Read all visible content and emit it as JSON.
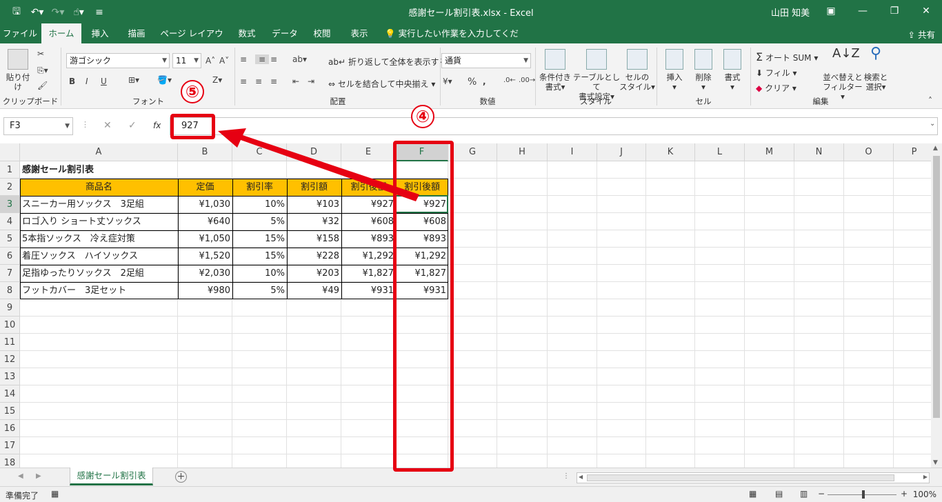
{
  "window": {
    "title": "感謝セール割引表.xlsx - Excel",
    "user": "山田 知美"
  },
  "ribbon_tabs": [
    "ファイル",
    "ホーム",
    "挿入",
    "描画",
    "ページ レイアウト",
    "数式",
    "データ",
    "校閲",
    "表示"
  ],
  "tell_me": "実行したい作業を入力してください",
  "share": "共有",
  "ribbon": {
    "clipboard": {
      "label": "クリップボード",
      "paste": "貼り付け"
    },
    "font": {
      "label": "フォント",
      "name": "游ゴシック",
      "size": "11",
      "bold": "B",
      "italic": "I",
      "underline": "U"
    },
    "alignment": {
      "label": "配置",
      "wrap": "折り返して全体を表示する",
      "merge": "セルを結合して中央揃え"
    },
    "number": {
      "label": "数値",
      "format": "通貨",
      "percent": "%"
    },
    "styles": {
      "label": "スタイル",
      "conditional": [
        "条件付き",
        "書式"
      ],
      "table": [
        "テーブルとして",
        "書式設定"
      ],
      "cell": [
        "セルの",
        "スタイル"
      ]
    },
    "cells": {
      "label": "セル",
      "insert": "挿入",
      "delete": "削除",
      "format": "書式"
    },
    "editing": {
      "label": "編集",
      "autosum": "オート SUM",
      "fill": "フィル",
      "clear": "クリア",
      "sort": [
        "並べ替えと",
        "フィルター"
      ],
      "find": [
        "検索と",
        "選択"
      ]
    }
  },
  "formula_bar": {
    "name_box": "F3",
    "value": "927",
    "fx": "fx"
  },
  "columns": [
    "A",
    "B",
    "C",
    "D",
    "E",
    "F",
    "G",
    "H",
    "I",
    "J",
    "K",
    "L",
    "M",
    "N",
    "O",
    "P"
  ],
  "rows": [
    "1",
    "2",
    "3",
    "4",
    "5",
    "6",
    "7",
    "8",
    "9",
    "10",
    "11",
    "12",
    "13",
    "14",
    "15",
    "16",
    "17",
    "18"
  ],
  "sheet": {
    "title": "感謝セール割引表",
    "headers": [
      "商品名",
      "定価",
      "割引率",
      "割引額",
      "割引後額",
      "割引後額"
    ],
    "data": [
      [
        "スニーカー用ソックス　3足組",
        "¥1,030",
        "10%",
        "¥103",
        "¥927",
        "¥927"
      ],
      [
        "ロゴ入り ショート丈ソックス",
        "¥640",
        "5%",
        "¥32",
        "¥608",
        "¥608"
      ],
      [
        "5本指ソックス　冷え症対策",
        "¥1,050",
        "15%",
        "¥158",
        "¥893",
        "¥893"
      ],
      [
        "着圧ソックス　ハイソックス",
        "¥1,520",
        "15%",
        "¥228",
        "¥1,292",
        "¥1,292"
      ],
      [
        "足指ゆったりソックス　2足組",
        "¥2,030",
        "10%",
        "¥203",
        "¥1,827",
        "¥1,827"
      ],
      [
        "フットカバー　3足セット",
        "¥980",
        "5%",
        "¥49",
        "¥931",
        "¥931"
      ]
    ]
  },
  "sheet_tab": "感謝セール割引表",
  "status": {
    "ready": "準備完了",
    "zoom": "100%"
  },
  "annotations": {
    "n4": "④",
    "n5": "⑤"
  },
  "colors": {
    "excel_green": "#217346",
    "header_fill": "#ffc000",
    "annotation_red": "#e60012"
  }
}
